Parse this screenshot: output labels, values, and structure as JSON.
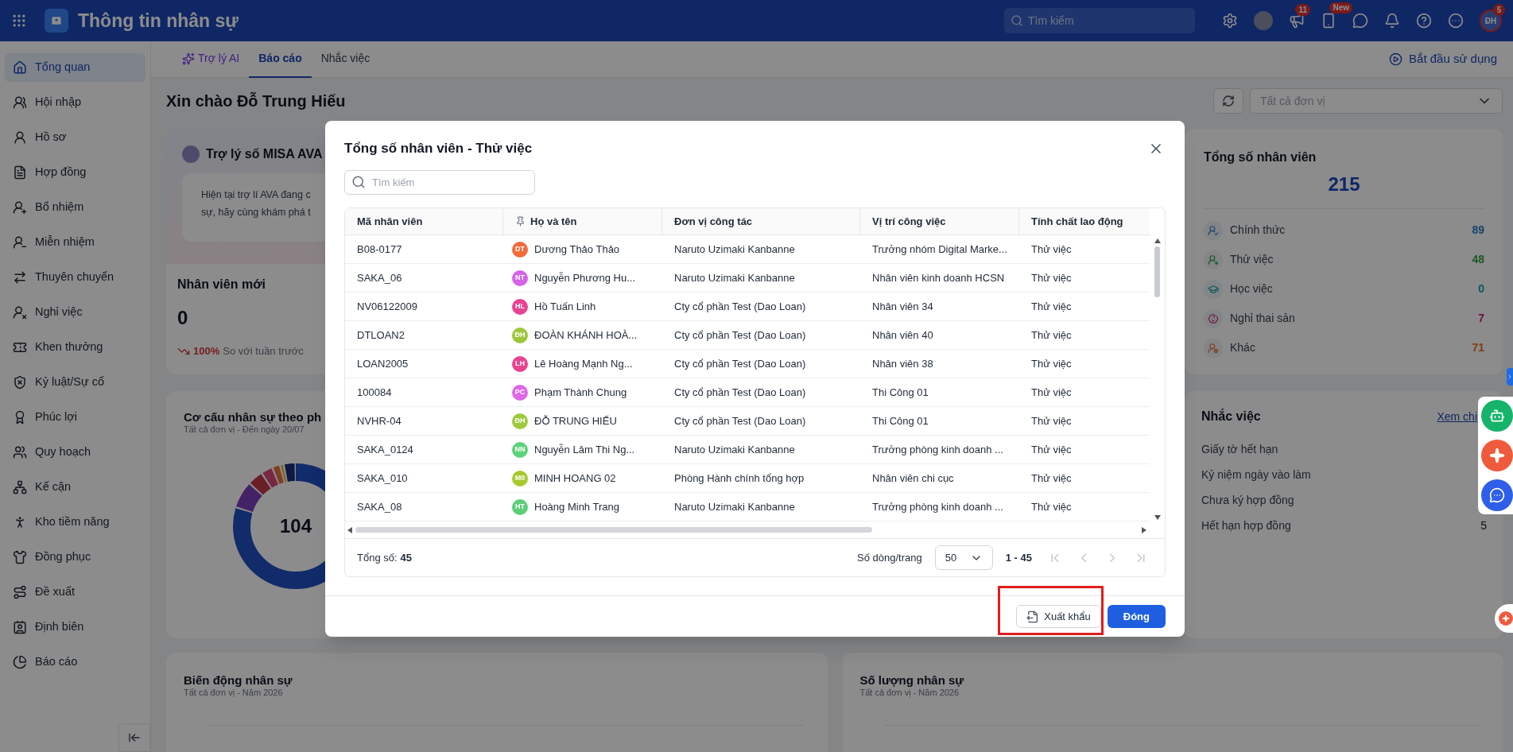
{
  "topbar": {
    "title": "Thông tin nhân sự",
    "search": {
      "placeholder": "Tìm kiếm"
    },
    "announcement_badge": "11",
    "new_badge": "New",
    "user_initials": "ĐH",
    "user_badge": "5"
  },
  "sidebar": {
    "items": [
      {
        "label": "Tổng quan",
        "selected": true
      },
      {
        "label": "Hội nhập",
        "selected": false
      },
      {
        "label": "Hồ sơ",
        "selected": false
      },
      {
        "label": "Hợp đồng",
        "selected": false
      },
      {
        "label": "Bổ nhiệm",
        "selected": false
      },
      {
        "label": "Miễn nhiệm",
        "selected": false
      },
      {
        "label": "Thuyên chuyển",
        "selected": false
      },
      {
        "label": "Nghỉ việc",
        "selected": false
      },
      {
        "label": "Khen thưởng",
        "selected": false
      },
      {
        "label": "Kỷ luật/Sự cố",
        "selected": false
      },
      {
        "label": "Phúc lợi",
        "selected": false
      },
      {
        "label": "Quy hoạch",
        "selected": false
      },
      {
        "label": "Kế cận",
        "selected": false
      },
      {
        "label": "Kho tiềm năng",
        "selected": false
      },
      {
        "label": "Đồng phục",
        "selected": false
      },
      {
        "label": "Đề xuất",
        "selected": false
      },
      {
        "label": "Định biên",
        "selected": false
      },
      {
        "label": "Báo cáo",
        "selected": false
      }
    ]
  },
  "tabs": [
    {
      "label": "Trợ lý AI",
      "kind": "ai",
      "selected": false
    },
    {
      "label": "Báo cáo",
      "kind": "plain",
      "selected": true
    },
    {
      "label": "Nhắc việc",
      "kind": "plain",
      "selected": false
    }
  ],
  "start_link": "Bắt đầu sử dụng",
  "greeting": "Xin chào Đỗ Trung Hiếu",
  "unit_select": {
    "placeholder": "Tất cả đơn vị"
  },
  "assistant_card": {
    "title": "Trợ lý số MISA AVA",
    "message_lines": [
      "Hiện tại trợ lí AVA đang c",
      "sự, hãy cùng khám phá t"
    ]
  },
  "new_employees": {
    "title": "Nhân viên mới",
    "value": "0",
    "change": "100%",
    "change_label": "So với tuần trước"
  },
  "structure_chart": {
    "title": "Cơ cấu nhân sự theo ph",
    "subtitle": "Tất cả đơn vị - Đến ngày 20/07",
    "center_value": "104"
  },
  "total_card": {
    "title": "Tổng số nhân viên",
    "total": "215",
    "items": [
      {
        "label": "Chính thức",
        "value": "89",
        "kind": "official"
      },
      {
        "label": "Thử việc",
        "value": "48",
        "kind": "probation"
      },
      {
        "label": "Học việc",
        "value": "0",
        "kind": "apprentice"
      },
      {
        "label": "Nghỉ thai sản",
        "value": "7",
        "kind": "maternity"
      },
      {
        "label": "Khác",
        "value": "71",
        "kind": "other"
      }
    ]
  },
  "reminders": {
    "title": "Nhắc việc",
    "link": "Xem chi",
    "items": [
      {
        "label": "Giấy tờ hết hạn"
      },
      {
        "label": "Kỷ niệm ngày vào làm"
      },
      {
        "label": "Chưa ký hợp đồng"
      },
      {
        "label": "Hết hạn hợp đồng",
        "count": "5"
      }
    ]
  },
  "bottom_cards": [
    {
      "title": "Biến động nhân sự",
      "subtitle": "Tất cả đơn vị - Năm 2026"
    },
    {
      "title": "Số lượng nhân sự",
      "subtitle": "Tất cả đơn vị - Năm 2026"
    }
  ],
  "dialog": {
    "title": "Tổng số nhân viên - Thử việc",
    "search": {
      "placeholder": "Tìm kiếm"
    },
    "columns": [
      {
        "label": "Mã nhân viên",
        "pinned": false
      },
      {
        "label": "Họ và tên",
        "pinned": true
      },
      {
        "label": "Đơn vị công tác",
        "pinned": false
      },
      {
        "label": "Vị trí công việc",
        "pinned": false
      },
      {
        "label": "Tính chất lao động",
        "pinned": false
      }
    ],
    "rows": [
      {
        "code": "B08-0177",
        "initials": "DT",
        "color": "#f26b3a",
        "name": "Dương Thảo Thảo",
        "unit": "Naruto Uzimaki Kanbanne",
        "position": "Trưởng nhóm Digital Marke...",
        "type": "Thử việc"
      },
      {
        "code": "SAKA_06",
        "initials": "NT",
        "color": "#d663e8",
        "name": "Nguyễn Phương Hu...",
        "unit": "Naruto Uzimaki Kanbanne",
        "position": "Nhân viên kinh doanh HCSN",
        "type": "Thử việc"
      },
      {
        "code": "NV06122009",
        "initials": "HL",
        "color": "#e84393",
        "name": "Hồ Tuấn Linh",
        "unit": "Cty cổ phần Test (Dao Loan)",
        "position": "Nhân viên 34",
        "type": "Thử việc"
      },
      {
        "code": "DTLOAN2",
        "initials": "ĐH",
        "color": "#9cc83a",
        "name": "ĐOÀN KHÁNH HOÀ...",
        "unit": "Cty cổ phần Test (Dao Loan)",
        "position": "Nhân viên 40",
        "type": "Thử việc"
      },
      {
        "code": "LOAN2005",
        "initials": "LH",
        "color": "#e8438e",
        "name": "Lê Hoàng Mạnh Ng...",
        "unit": "Cty cổ phần Test (Dao Loan)",
        "position": "Nhân viên 38",
        "type": "Thử việc"
      },
      {
        "code": "100084",
        "initials": "PC",
        "color": "#df66e6",
        "name": "Phạm Thành Chung",
        "unit": "Cty cổ phần Test (Dao Loan)",
        "position": "Thi Công 01",
        "type": "Thử việc"
      },
      {
        "code": "NVHR-04",
        "initials": "ĐH",
        "color": "#9fc93c",
        "name": "ĐỖ TRUNG HIẾU",
        "unit": "Cty cổ phần Test (Dao Loan)",
        "position": "Thi Công 01",
        "type": "Thử việc"
      },
      {
        "code": "SAKA_0124",
        "initials": "NN",
        "color": "#5fd27c",
        "name": "Nguyễn Lâm Thi Ng...",
        "unit": "Naruto Uzimaki Kanbanne",
        "position": "Trưởng phòng kinh doanh ...",
        "type": "Thử việc"
      },
      {
        "code": "SAKA_010",
        "initials": "M0",
        "color": "#a8c92e",
        "name": "MINH HOANG 02",
        "unit": "Phòng Hành chính tổng hợp",
        "position": "Nhân viên chi cục",
        "type": "Thử việc"
      },
      {
        "code": "SAKA_08",
        "initials": "HT",
        "color": "#5cce78",
        "name": "Hoàng Minh Trang",
        "unit": "Naruto Uzimaki Kanbanne",
        "position": "Trưởng phòng kinh doanh ...",
        "type": "Thử việc"
      }
    ],
    "total_label": "Tổng số:",
    "total": "45",
    "page_size_label": "Số dòng/trang",
    "page_size": "50",
    "range": "1 - 45",
    "nav_buttons": [
      {
        "kind": "first",
        "disabled": true
      },
      {
        "kind": "prev",
        "disabled": true
      },
      {
        "kind": "next",
        "disabled": true
      },
      {
        "kind": "last",
        "disabled": true
      }
    ],
    "buttons": [
      {
        "label": "Xuất khẩu",
        "kind": "secondary",
        "highlighted": true
      },
      {
        "label": "Đóng",
        "kind": "primary",
        "highlighted": false
      }
    ]
  }
}
